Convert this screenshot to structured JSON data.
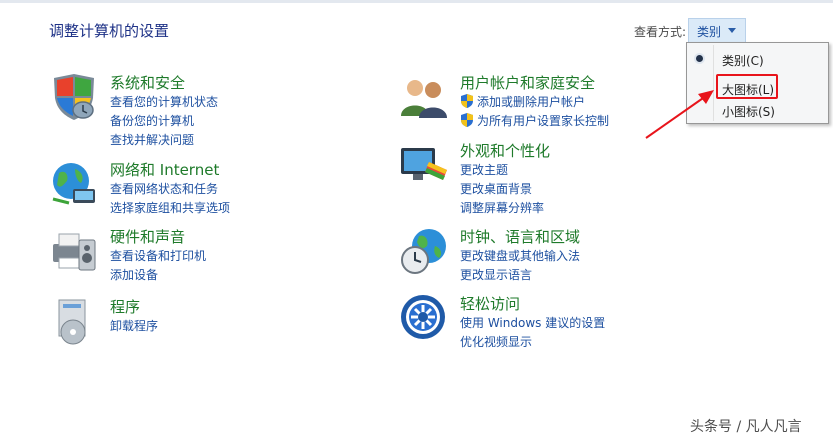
{
  "header": {
    "title": "调整计算机的设置",
    "view_by_label": "查看方式:",
    "view_by_value": "类别"
  },
  "view_menu": {
    "items": [
      {
        "label": "类别(C)",
        "selected": true
      },
      {
        "label": "大图标(L)",
        "highlighted": true
      },
      {
        "label": "小图标(S)"
      }
    ]
  },
  "left_column": [
    {
      "title": "系统和安全",
      "icon": "security-shield-icon",
      "links": [
        {
          "text": "查看您的计算机状态"
        },
        {
          "text": "备份您的计算机"
        },
        {
          "text": "查找并解决问题"
        }
      ]
    },
    {
      "title": "网络和 Internet",
      "icon": "network-globe-icon",
      "links": [
        {
          "text": "查看网络状态和任务"
        },
        {
          "text": "选择家庭组和共享选项"
        }
      ]
    },
    {
      "title": "硬件和声音",
      "icon": "printer-hardware-icon",
      "links": [
        {
          "text": "查看设备和打印机"
        },
        {
          "text": "添加设备"
        }
      ]
    },
    {
      "title": "程序",
      "icon": "programs-disc-icon",
      "links": [
        {
          "text": "卸载程序"
        }
      ]
    }
  ],
  "right_column": [
    {
      "title": "用户帐户和家庭安全",
      "icon": "users-icon",
      "links": [
        {
          "text": "添加或删除用户帐户",
          "shield": true
        },
        {
          "text": "为所有用户设置家长控制",
          "shield": true
        }
      ]
    },
    {
      "title": "外观和个性化",
      "icon": "monitor-palette-icon",
      "links": [
        {
          "text": "更改主题"
        },
        {
          "text": "更改桌面背景"
        },
        {
          "text": "调整屏幕分辨率"
        }
      ]
    },
    {
      "title": "时钟、语言和区域",
      "icon": "clock-globe-icon",
      "links": [
        {
          "text": "更改键盘或其他输入法"
        },
        {
          "text": "更改显示语言"
        }
      ]
    },
    {
      "title": "轻松访问",
      "icon": "ease-of-access-icon",
      "links": [
        {
          "text": "使用 Windows 建议的设置"
        },
        {
          "text": "优化视频显示"
        }
      ]
    }
  ],
  "watermark": "头条号 / 凡人凡言",
  "colors": {
    "title": "#1e3287",
    "category_title": "#1e7a2a",
    "link": "#1e50a0",
    "annotation_red": "#e8141b"
  }
}
